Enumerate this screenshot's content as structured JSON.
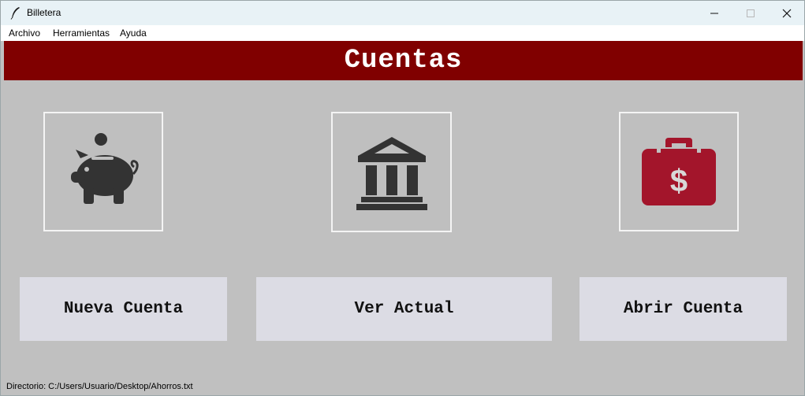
{
  "window": {
    "title": "Billetera"
  },
  "menu": {
    "items": [
      "Archivo",
      "Herramientas",
      "Ayuda"
    ]
  },
  "header": {
    "title": "Cuentas"
  },
  "icons": [
    {
      "name": "piggy-bank-icon",
      "color": "#333333"
    },
    {
      "name": "bank-building-icon",
      "color": "#333333"
    },
    {
      "name": "money-briefcase-icon",
      "color": "#a3152b"
    }
  ],
  "buttons": [
    "Nueva Cuenta",
    "Ver Actual",
    "Abrir Cuenta"
  ],
  "status": {
    "text": "Directorio: C:/Users/Usuario/Desktop/Ahorros.txt"
  },
  "colors": {
    "header_bg": "#800000",
    "content_bg": "#c0c0c0",
    "button_bg": "#dcdce4",
    "accent_red": "#a3152b"
  }
}
